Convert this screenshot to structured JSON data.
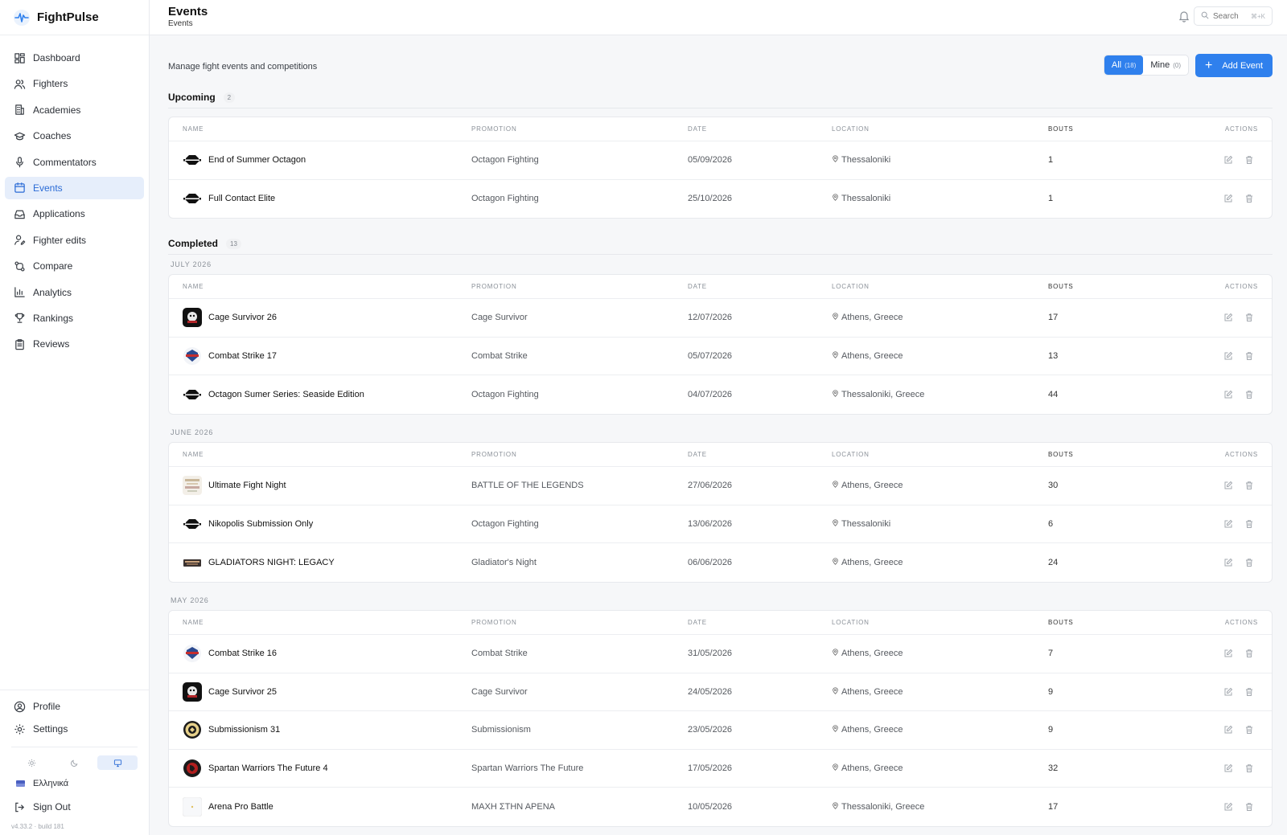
{
  "app": {
    "name": "FightPulse",
    "version": "v4.33.2 · build 181"
  },
  "sidebar": {
    "items": [
      {
        "label": "Dashboard",
        "icon": "dashboard-icon"
      },
      {
        "label": "Fighters",
        "icon": "users-icon"
      },
      {
        "label": "Academies",
        "icon": "building-icon"
      },
      {
        "label": "Coaches",
        "icon": "graduation-cap-icon"
      },
      {
        "label": "Commentators",
        "icon": "microphone-icon"
      },
      {
        "label": "Events",
        "icon": "calendar-icon",
        "active": true
      },
      {
        "label": "Applications",
        "icon": "inbox-icon"
      },
      {
        "label": "Fighter edits",
        "icon": "user-edit-icon"
      },
      {
        "label": "Compare",
        "icon": "compare-icon"
      },
      {
        "label": "Analytics",
        "icon": "bar-chart-icon"
      },
      {
        "label": "Rankings",
        "icon": "trophy-icon"
      },
      {
        "label": "Reviews",
        "icon": "clipboard-icon"
      }
    ],
    "bottom": {
      "profile": "Profile",
      "settings": "Settings",
      "language": "Ελληνικά",
      "signout": "Sign Out"
    }
  },
  "header": {
    "title": "Events",
    "breadcrumb": "Events",
    "search_placeholder": "Search",
    "search_shortcut": "⌘+K"
  },
  "main": {
    "subtitle": "Manage fight events and competitions",
    "filters": {
      "all_label": "All",
      "all_count": "(18)",
      "mine_label": "Mine",
      "mine_count": "(0)"
    },
    "add_button": "Add Event",
    "columns": {
      "name": "NAME",
      "promotion": "PROMOTION",
      "date": "DATE",
      "location": "LOCATION",
      "bouts": "BOUTS",
      "actions": "ACTIONS"
    },
    "upcoming": {
      "title": "Upcoming",
      "count": "2",
      "rows": [
        {
          "name": "End of Summer Octagon",
          "promotion": "Octagon Fighting",
          "date": "05/09/2026",
          "location": "Thessaloniki",
          "bouts": "1",
          "logo": "octagon"
        },
        {
          "name": "Full Contact Elite",
          "promotion": "Octagon Fighting",
          "date": "25/10/2026",
          "location": "Thessaloniki",
          "bouts": "1",
          "logo": "octagon"
        }
      ]
    },
    "completed": {
      "title": "Completed",
      "count": "13",
      "groups": [
        {
          "month": "JULY 2026",
          "rows": [
            {
              "name": "Cage Survivor 26",
              "promotion": "Cage Survivor",
              "date": "12/07/2026",
              "location": "Athens, Greece",
              "bouts": "17",
              "logo": "cage"
            },
            {
              "name": "Combat Strike 17",
              "promotion": "Combat Strike",
              "date": "05/07/2026",
              "location": "Athens, Greece",
              "bouts": "13",
              "logo": "strike"
            },
            {
              "name": "Octagon Sumer Series: Seaside Edition",
              "promotion": "Octagon Fighting",
              "date": "04/07/2026",
              "location": "Thessaloniki, Greece",
              "bouts": "44",
              "logo": "octagon"
            }
          ]
        },
        {
          "month": "JUNE 2026",
          "rows": [
            {
              "name": "Ultimate Fight Night",
              "promotion": "BATTLE OF THE LEGENDS",
              "date": "27/06/2026",
              "location": "Athens, Greece",
              "bouts": "30",
              "logo": "legends"
            },
            {
              "name": "Nikopolis Submission Only",
              "promotion": "Octagon Fighting",
              "date": "13/06/2026",
              "location": "Thessaloniki",
              "bouts": "6",
              "logo": "octagon"
            },
            {
              "name": "GLADIATORS NIGHT: LEGACY",
              "promotion": "Gladiator's Night",
              "date": "06/06/2026",
              "location": "Athens, Greece",
              "bouts": "24",
              "logo": "gladiator"
            }
          ]
        },
        {
          "month": "MAY 2026",
          "rows": [
            {
              "name": "Combat Strike 16",
              "promotion": "Combat Strike",
              "date": "31/05/2026",
              "location": "Athens, Greece",
              "bouts": "7",
              "logo": "strike"
            },
            {
              "name": "Cage Survivor 25",
              "promotion": "Cage Survivor",
              "date": "24/05/2026",
              "location": "Athens, Greece",
              "bouts": "9",
              "logo": "cage"
            },
            {
              "name": "Submissionism 31",
              "promotion": "Submissionism",
              "date": "23/05/2026",
              "location": "Athens, Greece",
              "bouts": "9",
              "logo": "submission"
            },
            {
              "name": "Spartan Warriors The Future 4",
              "promotion": "Spartan Warriors The Future",
              "date": "17/05/2026",
              "location": "Athens, Greece",
              "bouts": "32",
              "logo": "spartan"
            },
            {
              "name": "Arena Pro Battle",
              "promotion": "ΜΑΧΗ ΣΤΗΝ ΑΡΕΝΑ",
              "date": "10/05/2026",
              "location": "Thessaloniki, Greece",
              "bouts": "17",
              "logo": "arena"
            }
          ]
        }
      ]
    }
  },
  "colors": {
    "accent": "#2f80ed",
    "active_bg": "#e6eefb"
  }
}
